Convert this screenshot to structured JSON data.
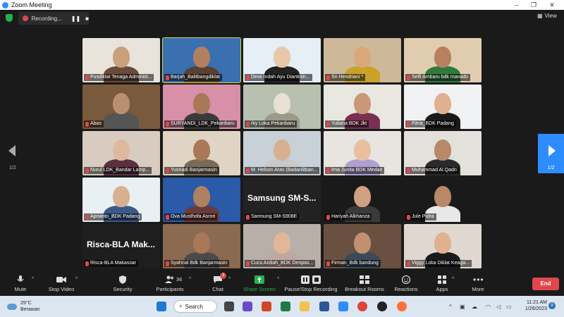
{
  "window": {
    "title": "Zoom Meeting",
    "controls": [
      "–",
      "❐",
      "✕"
    ]
  },
  "recording": {
    "label": "Recording...",
    "pause_label": "❚❚",
    "stop_label": "■"
  },
  "view": {
    "label": "View"
  },
  "pagination": {
    "left": "1/2",
    "right": "1/2"
  },
  "participants_grid": [
    {
      "name": "Pusdiklat Tenaga Administ...",
      "bg": "#e8e4dc",
      "skin": "#c8a07a",
      "shirt": "#6b4a3a",
      "big": ""
    },
    {
      "name": "Barjah_Balitbangdiklat",
      "bg": "#3a6fb0",
      "skin": "#b08060",
      "shirt": "#5a4030",
      "big": ""
    },
    {
      "name": "Dewi Indah Ayu Diantinin...",
      "bg": "#e6eef6",
      "skin": "#e8c8a8",
      "shirt": "#222222",
      "big": ""
    },
    {
      "name": "Sri Hendriani *",
      "bg": "#cdb89a",
      "skin": "#d8a87a",
      "shirt": "#c9a227",
      "big": ""
    },
    {
      "name": "Selfi Ambaru bdk manado",
      "bg": "#e0cdb0",
      "skin": "#b88060",
      "shirt": "#2f7a3a",
      "big": ""
    },
    {
      "name": "Abas",
      "bg": "#7a5a3c",
      "skin": "#b89070",
      "shirt": "#555555",
      "big": ""
    },
    {
      "name": "SURYANDI_LDK_Pekanbaru",
      "bg": "#d890a8",
      "skin": "#a87858",
      "shirt": "#3a3a3a",
      "big": ""
    },
    {
      "name": "rky Loka Pekanbaru",
      "bg": "#b8c0b0",
      "skin": "#e8e0d0",
      "shirt": "#9a9a8a",
      "big": ""
    },
    {
      "name": "Yuliana BDK Jkt",
      "bg": "#e8e8e0",
      "skin": "#c89878",
      "shirt": "#7a3050",
      "big": ""
    },
    {
      "name": "Fitria_BDK Padang",
      "bg": "#f0f2f4",
      "skin": "#e0b090",
      "shirt": "#1a1a1a",
      "big": ""
    },
    {
      "name": "Nurul LDK_Bandar Lamp...",
      "bg": "#d8ccc0",
      "skin": "#e0b8a0",
      "shirt": "#5a3040",
      "big": ""
    },
    {
      "name": "Yusnadi Banjarmasin",
      "bg": "#e0d4c4",
      "skin": "#a87858",
      "shirt": "#7a6a5a",
      "big": ""
    },
    {
      "name": "M. Helson Aras (Badanlitban...",
      "bg": "#c8d0d8",
      "skin": "#d8b090",
      "shirt": "#c8c8c8",
      "big": ""
    },
    {
      "name": "Irna Junita BDK Medan",
      "bg": "#e8e4e0",
      "skin": "#e8c0a0",
      "shirt": "#b0a0d0",
      "big": ""
    },
    {
      "name": "Muhammad Al Qadri",
      "bg": "#e4e0dc",
      "skin": "#b88868",
      "shirt": "#2a2a2a",
      "big": ""
    },
    {
      "name": "Aprianto_BDK Padang",
      "bg": "#e8f0f4",
      "skin": "#d8b090",
      "shirt": "#3a5a8a",
      "big": ""
    },
    {
      "name": "Ova Musthofa Asrori",
      "bg": "#2a5aa8",
      "skin": "#b08060",
      "shirt": "#6a3a3a",
      "big": ""
    },
    {
      "name": "Samsung SM-S908E",
      "bg": "#222222",
      "skin": "",
      "shirt": "",
      "big": "Samsung SM-S..."
    },
    {
      "name": "Hariyah Alkhanza",
      "bg": "#1a1a1a",
      "skin": "#d0a080",
      "shirt": "#3a3a3a",
      "big": ""
    },
    {
      "name": "Jule Putra",
      "bg": "#1a1a1a",
      "skin": "#b88868",
      "shirt": "#e8e8e8",
      "big": ""
    },
    {
      "name": "Risca-BLA Makassar",
      "bg": "#1e1e1e",
      "skin": "",
      "shirt": "",
      "big": "Risca-BLA Mak..."
    },
    {
      "name": "Syahrial Bdk Banjarmasin",
      "bg": "#8a6a50",
      "skin": "#a87858",
      "shirt": "#4a4a4a",
      "big": ""
    },
    {
      "name": "Cucu Ardiah_BDK Denpas...",
      "bg": "#b8b0a8",
      "skin": "#e0b898",
      "shirt": "#c0a8a0",
      "big": ""
    },
    {
      "name": "Firman_Bdk bandung",
      "bg": "#6a5040",
      "skin": "#c09070",
      "shirt": "#3a4a5a",
      "big": ""
    },
    {
      "name": "Viggy Loka Diklat Keaga...",
      "bg": "#e0d8d0",
      "skin": "#e0b090",
      "shirt": "#1a1a1a",
      "big": ""
    }
  ],
  "toolbar": {
    "mute": "Mute",
    "stop_video": "Stop Video",
    "security": "Security",
    "participants": "Participants",
    "participants_count": "36",
    "chat": "Chat",
    "chat_badge": "3",
    "share_screen": "Share Screen",
    "pause_recording": "Pause/Stop Recording",
    "breakout_rooms": "Breakout Rooms",
    "reactions": "Reactions",
    "apps": "Apps",
    "more": "More",
    "end": "End"
  },
  "taskbar": {
    "temp": "29°C",
    "weather": "Berawan",
    "search": "Search",
    "time": "11:21 AM",
    "date": "1/26/2023",
    "notifications": "8"
  },
  "colors": {
    "accent": "#2d8cff",
    "end": "#e0474c",
    "share": "#22b14c",
    "active_speaker": "#d4d64a"
  }
}
